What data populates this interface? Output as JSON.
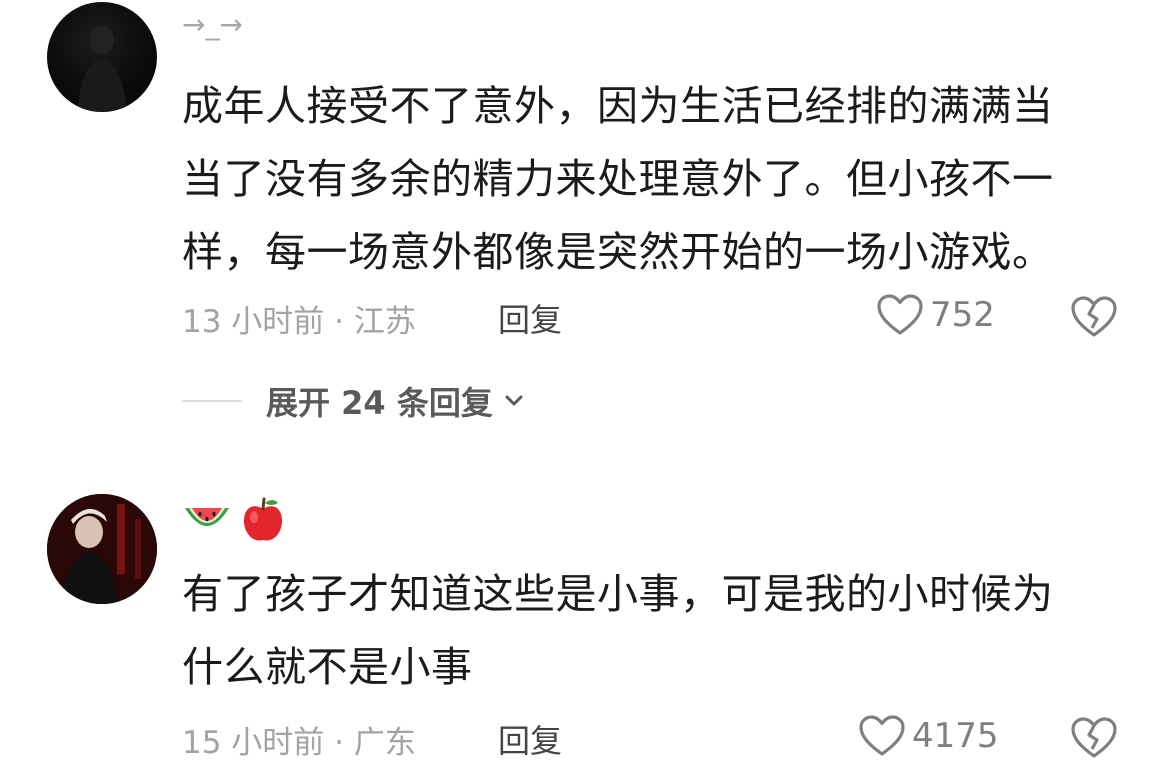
{
  "comments": [
    {
      "username": "→_→",
      "text_lines": [
        "成年人接受不了意外，因为生活已经排的满满当",
        "当了没有多余的精力来处理意外了。但小孩不一",
        "样，每一场意外都像是突然开始的一场小游戏。"
      ],
      "meta": "13 小时前 · 江苏",
      "reply_label": "回复",
      "likes": "752",
      "expand_label": "展开 24 条回复"
    },
    {
      "username": "",
      "emoji_names": [
        "watermelon-icon",
        "apple-icon"
      ],
      "text_lines": [
        "有了孩子才知道这些是小事，可是我的小时候为",
        "什么就不是小事"
      ],
      "meta": "15 小时前 · 广东",
      "reply_label": "回复",
      "likes": "4175"
    }
  ],
  "colors": {
    "text": "#1b1b1b",
    "meta": "#a3a3a3",
    "icon": "#7f7f7f"
  }
}
